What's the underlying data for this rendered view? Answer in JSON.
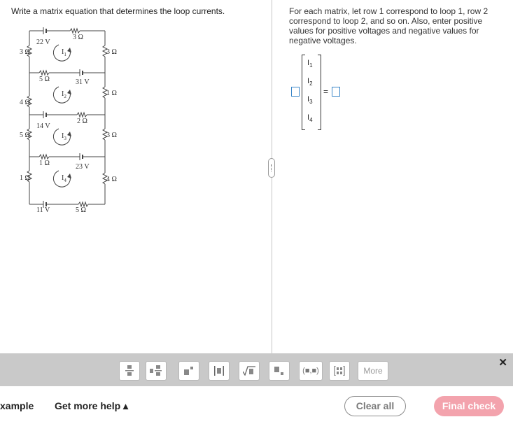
{
  "question": {
    "text": "Write a matrix equation that determines the loop currents."
  },
  "circuit": {
    "labels": {
      "r_top": "3 Ω",
      "v_top": "22 V",
      "r_left_1": "3 Ω",
      "r_right_1": "3 Ω",
      "loop_1": "I",
      "loop_1_sub": "1",
      "r_mid12_left": "5 Ω",
      "v_mid12_right": "31 V",
      "r_left_2": "4 Ω",
      "r_right_2": "1 Ω",
      "loop_2": "I",
      "loop_2_sub": "2",
      "v_mid23_left": "14 V",
      "r_mid23_right": "2 Ω",
      "r_left_3": "5 Ω",
      "r_right_3": "3 Ω",
      "loop_3": "I",
      "loop_3_sub": "3",
      "r_mid34_left": "1 Ω",
      "v_mid34_right": "23 V",
      "r_left_4": "1 Ω",
      "r_right_4": "4 Ω",
      "loop_4": "I",
      "loop_4_sub": "4",
      "v_bottom": "11 V",
      "r_bottom": "5 Ω"
    }
  },
  "instructions": "For each matrix, let row 1 correspond to loop 1, row 2 correspond to loop 2, and so on. Also, enter positive values for positive voltages and negative values for negative voltages.",
  "equation": {
    "vector": [
      {
        "sym": "I",
        "sub": "1"
      },
      {
        "sym": "I",
        "sub": "2"
      },
      {
        "sym": "I",
        "sub": "3"
      },
      {
        "sym": "I",
        "sub": "4"
      }
    ],
    "equals": "="
  },
  "toolbar": {
    "tools": [
      "fraction",
      "mixed-number",
      "exponent",
      "absolute-value",
      "square-root",
      "subscript",
      "ordered-pair",
      "matrix"
    ],
    "paren_label": "(■,■)",
    "more_label": "More",
    "close_label": "✕"
  },
  "footer": {
    "left_label": "xample",
    "help_label": "Get more help ▴",
    "clear_label": "Clear all",
    "final_label": "Final check"
  },
  "colors": {
    "accent_box": "#3a86c8",
    "final_button": "#f3a3ad",
    "toolbar_bg": "#c9c9c9"
  }
}
